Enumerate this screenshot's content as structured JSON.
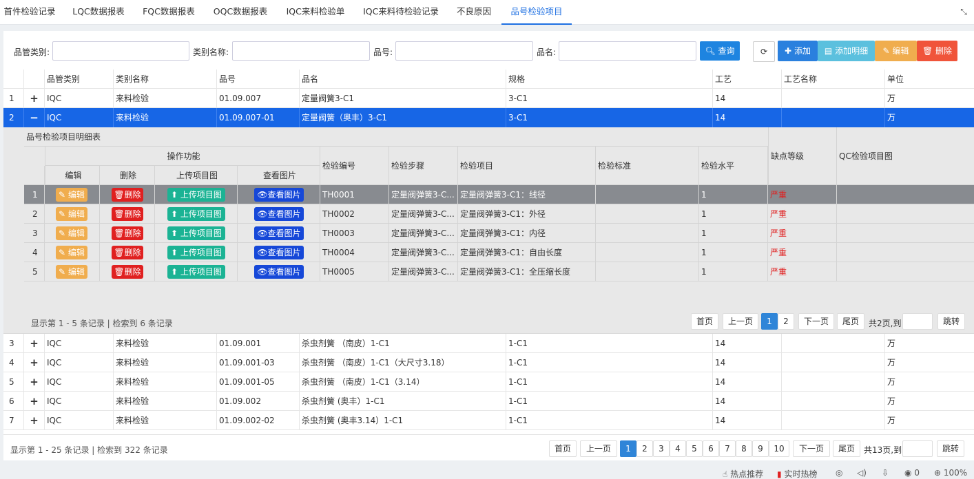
{
  "tabs": [
    "首件检验记录",
    "LQC数据报表",
    "FQC数据报表",
    "OQC数据报表",
    "IQC来料检验单",
    "IQC来料待检验记录",
    "不良原因",
    "品号检验项目"
  ],
  "filters": {
    "category_label": "品管类别:",
    "catname_label": "类别名称:",
    "partno_label": "品号:",
    "partname_label": "品名:",
    "category_value": "",
    "catname_value": "",
    "partno_value": "",
    "partname_value": ""
  },
  "toolbar": {
    "query": "查询",
    "add": "添加",
    "add_detail": "添加明细",
    "edit": "编辑",
    "delete": "删除"
  },
  "columns": [
    "品管类别",
    "类别名称",
    "品号",
    "品名",
    "规格",
    "工艺",
    "工艺名称",
    "单位"
  ],
  "rows": [
    {
      "n": "1",
      "exp": "+",
      "c": [
        "IQC",
        "来料检验",
        "01.09.007",
        "定量阀簧3-C1",
        "3-C1",
        "14",
        "",
        "万"
      ]
    },
    {
      "n": "2",
      "exp": "−",
      "c": [
        "IQC",
        "来料检验",
        "01.09.007-01",
        "定量阀簧（奥丰）3-C1",
        "3-C1",
        "14",
        "",
        "万"
      ]
    },
    {
      "n": "3",
      "exp": "+",
      "c": [
        "IQC",
        "来料检验",
        "01.09.001",
        "杀虫剂簧 （南皮）1-C1",
        "1-C1",
        "14",
        "",
        "万"
      ]
    },
    {
      "n": "4",
      "exp": "+",
      "c": [
        "IQC",
        "来料检验",
        "01.09.001-03",
        "杀虫剂簧 （南皮）1-C1（大尺寸3.18）",
        "1-C1",
        "14",
        "",
        "万"
      ]
    },
    {
      "n": "5",
      "exp": "+",
      "c": [
        "IQC",
        "来料检验",
        "01.09.001-05",
        "杀虫剂簧 （南皮）1-C1（3.14）",
        "1-C1",
        "14",
        "",
        "万"
      ]
    },
    {
      "n": "6",
      "exp": "+",
      "c": [
        "IQC",
        "来料检验",
        "01.09.002",
        "杀虫剂簧 (奥丰）1-C1",
        "1-C1",
        "14",
        "",
        "万"
      ]
    },
    {
      "n": "7",
      "exp": "+",
      "c": [
        "IQC",
        "来料检验",
        "01.09.002-02",
        "杀虫剂簧 (奥丰3.14）1-C1",
        "1-C1",
        "14",
        "",
        "万"
      ]
    }
  ],
  "detail": {
    "title": "品号检验项目明细表",
    "op_header": "操作功能",
    "op_cols": [
      "编辑",
      "删除",
      "上传项目图",
      "查看图片"
    ],
    "cols": [
      "检验编号",
      "检验步骤",
      "检验项目",
      "检验标准",
      "检验水平",
      "缺点等级",
      "QC检验项目图"
    ],
    "btn": {
      "edit": "编辑",
      "delete": "删除",
      "upload": "上传项目图",
      "view": "查看图片"
    },
    "rows": [
      {
        "n": "1",
        "code": "TH0001",
        "step": "定量阀弹簧3-C...",
        "item": "定量阀弹簧3-C1：线径",
        "std": "",
        "level": "1",
        "grade": "严重",
        "img": ""
      },
      {
        "n": "2",
        "code": "TH0002",
        "step": "定量阀弹簧3-C...",
        "item": "定量阀弹簧3-C1：外径",
        "std": "",
        "level": "1",
        "grade": "严重",
        "img": ""
      },
      {
        "n": "3",
        "code": "TH0003",
        "step": "定量阀弹簧3-C...",
        "item": "定量阀弹簧3-C1：内径",
        "std": "",
        "level": "1",
        "grade": "严重",
        "img": ""
      },
      {
        "n": "4",
        "code": "TH0004",
        "step": "定量阀弹簧3-C...",
        "item": "定量阀弹簧3-C1：自由长度",
        "std": "",
        "level": "1",
        "grade": "严重",
        "img": ""
      },
      {
        "n": "5",
        "code": "TH0005",
        "step": "定量阀弹簧3-C...",
        "item": "定量阀弹簧3-C1：全压缩长度",
        "std": "",
        "level": "1",
        "grade": "严重",
        "img": ""
      }
    ],
    "info": "显示第 1 - 5 条记录 | 检索到 6 条记录",
    "pager": {
      "first": "首页",
      "prev": "上一页",
      "pages": [
        "1",
        "2"
      ],
      "next": "下一页",
      "last": "尾页",
      "total": "共2页,到",
      "go": "跳转"
    }
  },
  "footer": {
    "info": "显示第 1 - 25 条记录 | 检索到 322 条记录",
    "pager": {
      "first": "首页",
      "prev": "上一页",
      "pages": [
        "1",
        "2",
        "3",
        "4",
        "5",
        "6",
        "7",
        "8",
        "9",
        "10"
      ],
      "next": "下一页",
      "last": "尾页",
      "total": "共13页,到",
      "go": "跳转"
    }
  },
  "statusbar": {
    "hot": "热点推荐",
    "rank": "实时热榜",
    "count": "0",
    "zoom": "100%"
  },
  "colors": {
    "accent": "#1766e6",
    "info": "#5bc0de",
    "warning": "#f0ad4e",
    "danger": "#f0543a",
    "success": "#1bb394",
    "severe": "#e02020"
  }
}
